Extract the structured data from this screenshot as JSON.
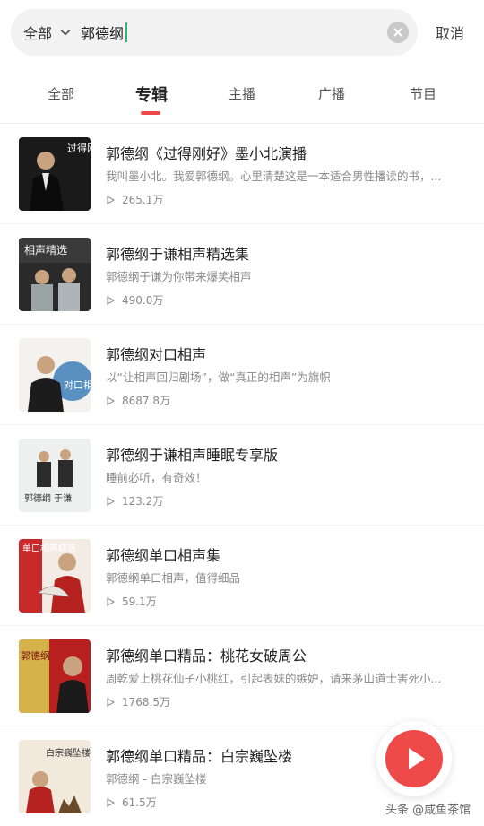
{
  "search": {
    "scope_label": "全部",
    "query": "郭德纲",
    "cancel_label": "取消"
  },
  "tabs": [
    {
      "label": "全部",
      "active": false
    },
    {
      "label": "专辑",
      "active": true
    },
    {
      "label": "主播",
      "active": false
    },
    {
      "label": "广播",
      "active": false
    },
    {
      "label": "节目",
      "active": false
    }
  ],
  "albums": [
    {
      "title": "郭德纲《过得刚好》墨小北演播",
      "desc": "我叫墨小北。我爱郭德纲。心里清楚这是一本适合男性播读的书，...",
      "plays": "265.1万"
    },
    {
      "title": "郭德纲于谦相声精选集",
      "desc": "郭德纲于谦为你带来爆笑相声",
      "plays": "490.0万"
    },
    {
      "title": "郭德纲对口相声",
      "desc": "以“让相声回归剧场”，做“真正的相声”为旗帜",
      "plays": "8687.8万"
    },
    {
      "title": "郭德纲于谦相声睡眠专享版",
      "desc": "睡前必听，有奇效！",
      "plays": "123.2万"
    },
    {
      "title": "郭德纲单口相声集",
      "desc": "郭德纲单口相声，值得细品",
      "plays": "59.1万"
    },
    {
      "title": "郭德纲单口精品：桃花女破周公",
      "desc": "周乾爱上桃花仙子小桃红，引起表妹的嫉妒，请来茅山道士害死小...",
      "plays": "1768.5万"
    },
    {
      "title": "郭德纲单口精品：白宗巍坠楼",
      "desc": "郭德纲 - 白宗巍坠楼",
      "plays": "61.5万"
    }
  ],
  "thumb_text": {
    "t1": "过得刚好",
    "t2": "相声精选",
    "t3": "对口相声",
    "t4": "郭德纲 于谦",
    "t5": "单口相声精选",
    "t6": "郭德纲",
    "t7": "白宗巍坠楼"
  },
  "watermark": "头条 @咸鱼茶馆",
  "colors": {
    "accent": "#ef4a4a",
    "caret": "#2bb673"
  }
}
